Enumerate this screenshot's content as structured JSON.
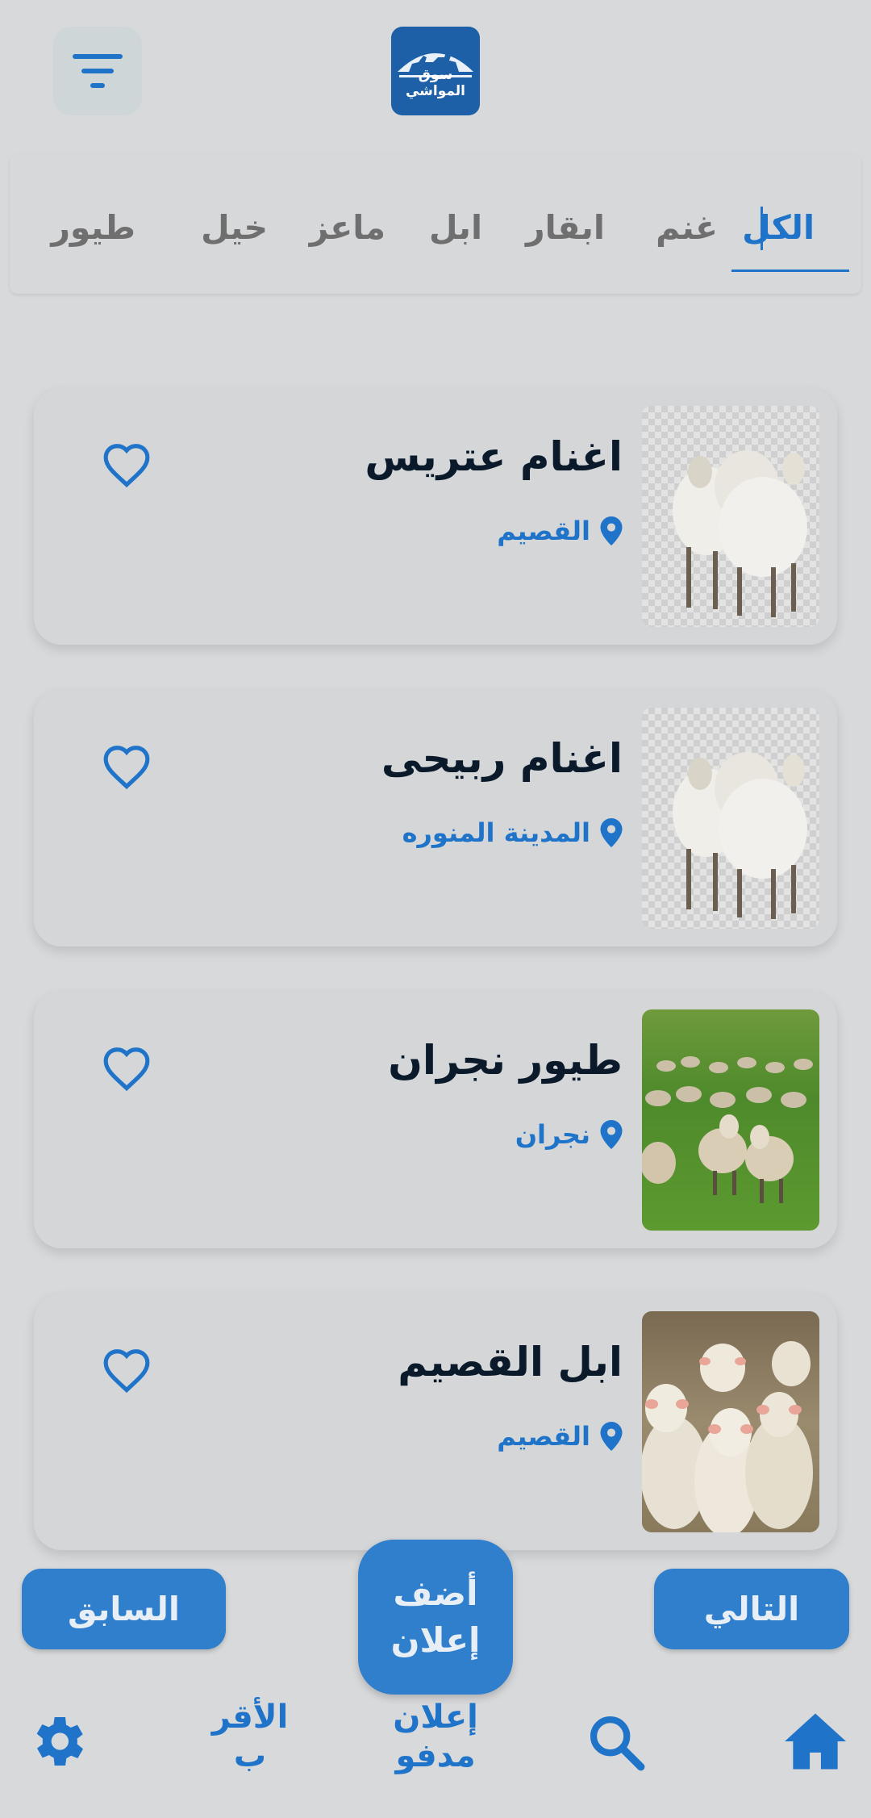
{
  "header": {
    "logo_text": "سوق المواشي",
    "filter_icon": "filter-lines-icon"
  },
  "tabs": [
    {
      "label": "الكل",
      "active": true
    },
    {
      "label": "غنم",
      "active": false
    },
    {
      "label": "ابقار",
      "active": false
    },
    {
      "label": "ابل",
      "active": false
    },
    {
      "label": "ماعز",
      "active": false
    },
    {
      "label": "خيل",
      "active": false
    },
    {
      "label": "طيور",
      "active": false
    }
  ],
  "listings": [
    {
      "title": "اغنام عتريس",
      "location": "القصيم",
      "image": "sheep-group-transparent"
    },
    {
      "title": "اغنام ربيحى",
      "location": "المدينة المنوره",
      "image": "sheep-group-transparent"
    },
    {
      "title": "طيور نجران",
      "location": "نجران",
      "image": "sheep-flock-field"
    },
    {
      "title": "ابل القصيم",
      "location": "القصيم",
      "image": "sheep-closeup-herd"
    }
  ],
  "pagination": {
    "next_label": "التالي",
    "prev_label": "السابق",
    "add_ad_label": "أضف\nإعلان"
  },
  "bottom_nav": {
    "home_icon": "home-icon",
    "search_icon": "search-icon",
    "paid_ads_label": "إعلان\nمدفو",
    "nearest_label": "الأقر\nب",
    "settings_icon": "gear-icon"
  },
  "colors": {
    "accent": "#1f74c9",
    "background": "#d8d9db",
    "card": "#d5d6d8",
    "logo_bg": "#1d60a8"
  }
}
